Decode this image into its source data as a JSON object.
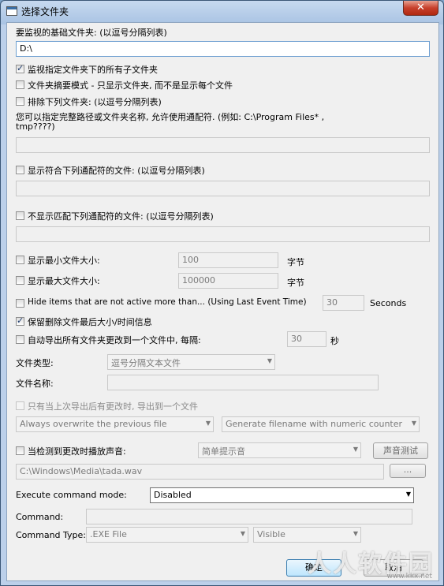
{
  "window": {
    "title": "选择文件夹",
    "close_glyph": "✕"
  },
  "base_folder": {
    "label": "要监视的基础文件夹: (以逗号分隔列表)",
    "value": "D:\\"
  },
  "options": {
    "subfolders": "监视指定文件夹下的所有子文件夹",
    "summary_mode": "文件夹摘要模式 - 只显示文件夹, 而不是显示每个文件",
    "exclude": "排除下列文件夹: (以逗号分隔列表)",
    "exclude_hint": "您可以指定完整路径或文件夹名称, 允许使用通配符. (例如: C:\\Program Files* ,",
    "exclude_hint2": "tmp????)",
    "include_wildcard": "显示符合下列通配符的文件: (以逗号分隔列表)",
    "exclude_wildcard": "不显示匹配下列通配符的文件: (以逗号分隔列表)",
    "min_size": "显示最小文件大小:",
    "min_size_value": "100",
    "max_size": "显示最大文件大小:",
    "max_size_value": "100000",
    "size_unit": "字节",
    "hide_inactive": "Hide items that are not active more than... (Using Last Event Time)",
    "hide_inactive_value": "30",
    "seconds": "Seconds",
    "keep_deleted": "保留删除文件最后大小/时间信息",
    "auto_export": "自动导出所有文件夹更改到一个文件中, 每隔:",
    "auto_export_value": "30",
    "sec_cn": "秒"
  },
  "export": {
    "file_type_label": "文件类型:",
    "file_type_value": "逗号分隔文本文件",
    "file_name_label": "文件名称:",
    "file_name_value": "",
    "only_changed": "只有当上次导出后有更改时, 导出到一个文件",
    "overwrite_mode": "Always overwrite the previous file",
    "filename_mode": "Generate filename with numeric counter"
  },
  "sound": {
    "label": "当检测到更改时播放声音:",
    "select_value": "简单提示音",
    "test_button": "声音测试",
    "path": "C:\\Windows\\Media\\tada.wav",
    "browse": "..."
  },
  "command": {
    "mode_label": "Execute command mode:",
    "mode_value": "Disabled",
    "command_label": "Command:",
    "command_value": "",
    "type_label": "Command Type:",
    "type_value": ".EXE File",
    "visibility_value": "Visible"
  },
  "buttons": {
    "ok": "确定",
    "cancel": "取消"
  },
  "watermark": {
    "text": "人人软件园",
    "sub": "www.kkx.net"
  }
}
